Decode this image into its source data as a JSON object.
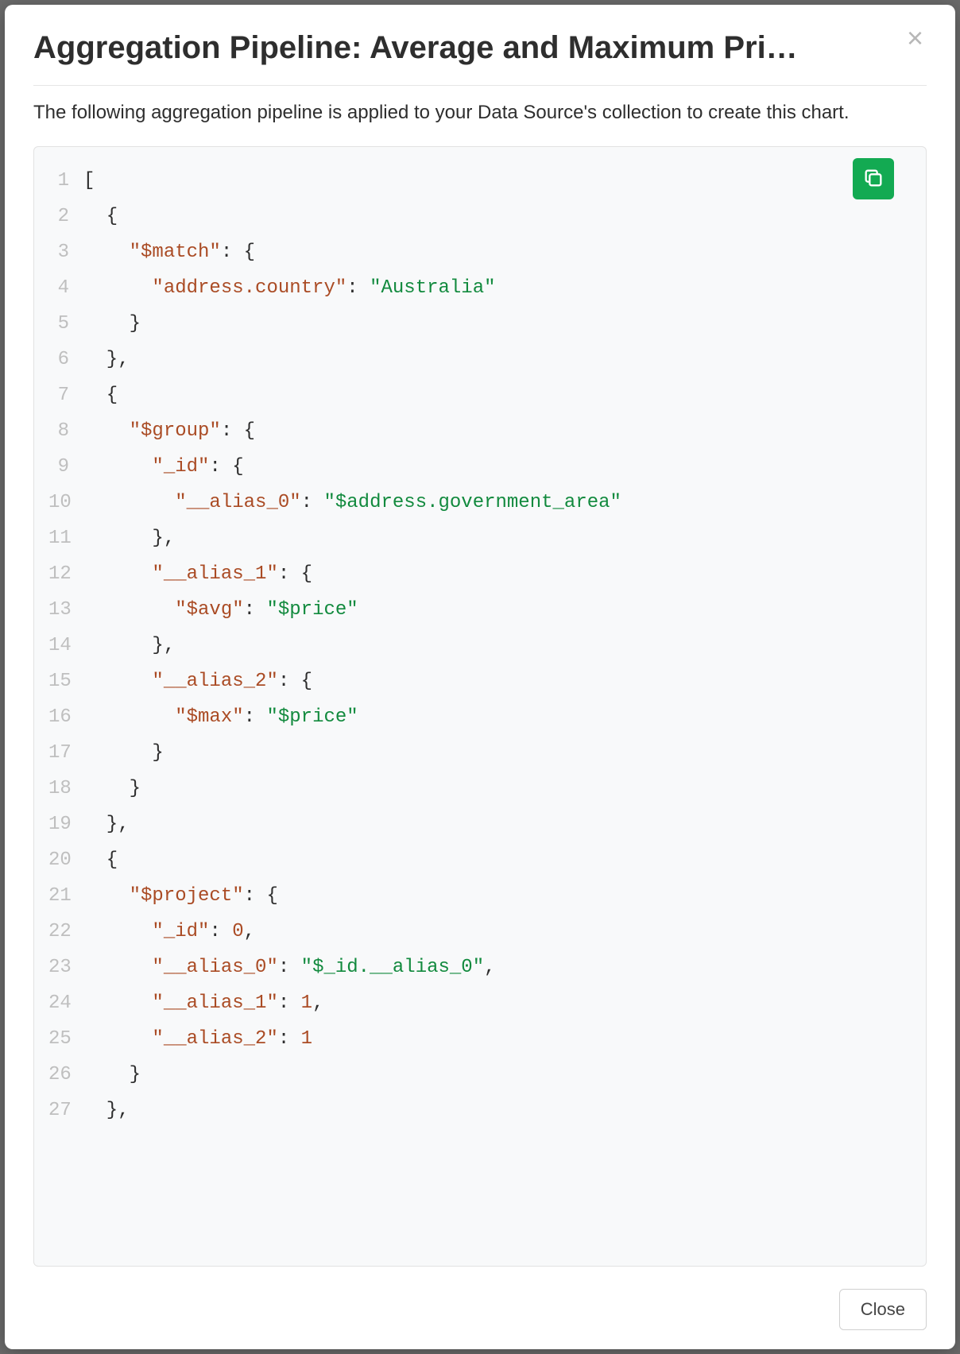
{
  "modal": {
    "title": "Aggregation Pipeline: Average and Maximum Pri…",
    "subtitle": "The following aggregation pipeline is applied to your Data Source's collection to create this chart.",
    "close_label": "Close",
    "close_x_label": "×"
  },
  "icons": {
    "copy": "copy-icon"
  },
  "code": {
    "lines": [
      {
        "n": 1,
        "tokens": [
          {
            "t": "punct",
            "v": "["
          }
        ]
      },
      {
        "n": 2,
        "tokens": [
          {
            "t": "punct",
            "v": "  {"
          }
        ]
      },
      {
        "n": 3,
        "tokens": [
          {
            "t": "punct",
            "v": "    "
          },
          {
            "t": "key",
            "v": "\"$match\""
          },
          {
            "t": "punct",
            "v": ": {"
          }
        ]
      },
      {
        "n": 4,
        "tokens": [
          {
            "t": "punct",
            "v": "      "
          },
          {
            "t": "key",
            "v": "\"address.country\""
          },
          {
            "t": "punct",
            "v": ": "
          },
          {
            "t": "str",
            "v": "\"Australia\""
          }
        ]
      },
      {
        "n": 5,
        "tokens": [
          {
            "t": "punct",
            "v": "    }"
          }
        ]
      },
      {
        "n": 6,
        "tokens": [
          {
            "t": "punct",
            "v": "  },"
          }
        ]
      },
      {
        "n": 7,
        "tokens": [
          {
            "t": "punct",
            "v": "  {"
          }
        ]
      },
      {
        "n": 8,
        "tokens": [
          {
            "t": "punct",
            "v": "    "
          },
          {
            "t": "key",
            "v": "\"$group\""
          },
          {
            "t": "punct",
            "v": ": {"
          }
        ]
      },
      {
        "n": 9,
        "tokens": [
          {
            "t": "punct",
            "v": "      "
          },
          {
            "t": "key",
            "v": "\"_id\""
          },
          {
            "t": "punct",
            "v": ": {"
          }
        ]
      },
      {
        "n": 10,
        "tokens": [
          {
            "t": "punct",
            "v": "        "
          },
          {
            "t": "key",
            "v": "\"__alias_0\""
          },
          {
            "t": "punct",
            "v": ": "
          },
          {
            "t": "str",
            "v": "\"$address.government_area\""
          }
        ]
      },
      {
        "n": 11,
        "tokens": [
          {
            "t": "punct",
            "v": "      },"
          }
        ]
      },
      {
        "n": 12,
        "tokens": [
          {
            "t": "punct",
            "v": "      "
          },
          {
            "t": "key",
            "v": "\"__alias_1\""
          },
          {
            "t": "punct",
            "v": ": {"
          }
        ]
      },
      {
        "n": 13,
        "tokens": [
          {
            "t": "punct",
            "v": "        "
          },
          {
            "t": "key",
            "v": "\"$avg\""
          },
          {
            "t": "punct",
            "v": ": "
          },
          {
            "t": "str",
            "v": "\"$price\""
          }
        ]
      },
      {
        "n": 14,
        "tokens": [
          {
            "t": "punct",
            "v": "      },"
          }
        ]
      },
      {
        "n": 15,
        "tokens": [
          {
            "t": "punct",
            "v": "      "
          },
          {
            "t": "key",
            "v": "\"__alias_2\""
          },
          {
            "t": "punct",
            "v": ": {"
          }
        ]
      },
      {
        "n": 16,
        "tokens": [
          {
            "t": "punct",
            "v": "        "
          },
          {
            "t": "key",
            "v": "\"$max\""
          },
          {
            "t": "punct",
            "v": ": "
          },
          {
            "t": "str",
            "v": "\"$price\""
          }
        ]
      },
      {
        "n": 17,
        "tokens": [
          {
            "t": "punct",
            "v": "      }"
          }
        ]
      },
      {
        "n": 18,
        "tokens": [
          {
            "t": "punct",
            "v": "    }"
          }
        ]
      },
      {
        "n": 19,
        "tokens": [
          {
            "t": "punct",
            "v": "  },"
          }
        ]
      },
      {
        "n": 20,
        "tokens": [
          {
            "t": "punct",
            "v": "  {"
          }
        ]
      },
      {
        "n": 21,
        "tokens": [
          {
            "t": "punct",
            "v": "    "
          },
          {
            "t": "key",
            "v": "\"$project\""
          },
          {
            "t": "punct",
            "v": ": {"
          }
        ]
      },
      {
        "n": 22,
        "tokens": [
          {
            "t": "punct",
            "v": "      "
          },
          {
            "t": "key",
            "v": "\"_id\""
          },
          {
            "t": "punct",
            "v": ": "
          },
          {
            "t": "num",
            "v": "0"
          },
          {
            "t": "punct",
            "v": ","
          }
        ]
      },
      {
        "n": 23,
        "tokens": [
          {
            "t": "punct",
            "v": "      "
          },
          {
            "t": "key",
            "v": "\"__alias_0\""
          },
          {
            "t": "punct",
            "v": ": "
          },
          {
            "t": "str",
            "v": "\"$_id.__alias_0\""
          },
          {
            "t": "punct",
            "v": ","
          }
        ]
      },
      {
        "n": 24,
        "tokens": [
          {
            "t": "punct",
            "v": "      "
          },
          {
            "t": "key",
            "v": "\"__alias_1\""
          },
          {
            "t": "punct",
            "v": ": "
          },
          {
            "t": "num",
            "v": "1"
          },
          {
            "t": "punct",
            "v": ","
          }
        ]
      },
      {
        "n": 25,
        "tokens": [
          {
            "t": "punct",
            "v": "      "
          },
          {
            "t": "key",
            "v": "\"__alias_2\""
          },
          {
            "t": "punct",
            "v": ": "
          },
          {
            "t": "num",
            "v": "1"
          }
        ]
      },
      {
        "n": 26,
        "tokens": [
          {
            "t": "punct",
            "v": "    }"
          }
        ]
      },
      {
        "n": 27,
        "tokens": [
          {
            "t": "punct",
            "v": "  },"
          }
        ]
      }
    ]
  }
}
